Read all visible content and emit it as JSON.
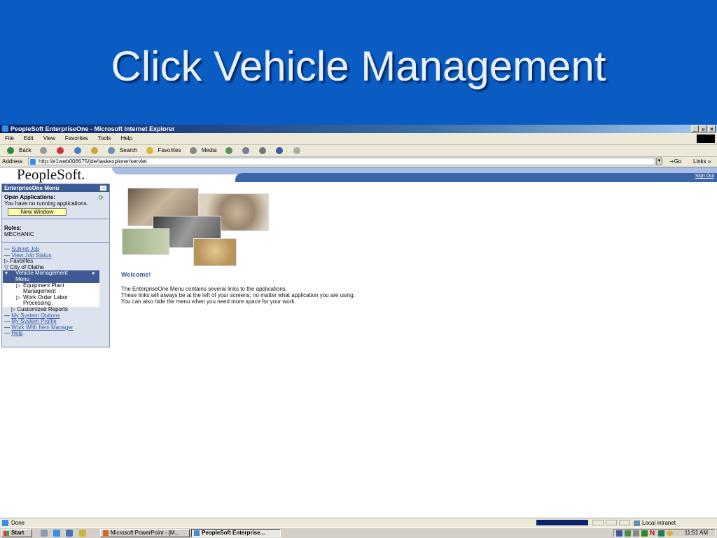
{
  "slide": {
    "title": "Click Vehicle Management"
  },
  "window": {
    "title": "PeopleSoft EnterpriseOne - Microsoft Internet Explorer",
    "controls": [
      "_",
      "»",
      "×"
    ]
  },
  "menu": [
    "File",
    "Edit",
    "View",
    "Favorites",
    "Tools",
    "Help"
  ],
  "toolbar": {
    "back": "Back",
    "search": "Search",
    "favorites": "Favorites",
    "media": "Media"
  },
  "address": {
    "label": "Address",
    "url": "http://e1web006675/jde/taskexplorer/servlet",
    "go": "Go",
    "links": "Links"
  },
  "portal": {
    "logo": "PeopleSoft.",
    "sign_out": "Sign Out"
  },
  "sidebar": {
    "header": "EnterpriseOne Menu",
    "open_apps_label": "Open Applications:",
    "no_apps": "You have no running applications.",
    "new_window": "New Window",
    "roles_label": "Roles:",
    "role": "MECHANIC",
    "tree": {
      "submit_job": "Submit Job",
      "view_job_status": "View Job Status",
      "favorites": "Favorites",
      "city": "City of Olathe",
      "vehicle_mgmt_line1": "Vehicle Management",
      "vehicle_mgmt_line2": "Menu",
      "equip_line1": "Equipment Plant",
      "equip_line2": "Management",
      "wo_line1": "Work Order Labor",
      "wo_line2": "Processing",
      "customized_reports": "Customized Reports",
      "system_options": "My System Options",
      "system_profile": "My System Profile",
      "item_manager": "Work With Item Manager",
      "help": "Help"
    }
  },
  "main": {
    "welcome": "Welcome!",
    "line1": "The EnterpriseOne Menu contains several links to the applications.",
    "line2": "These links will always be at the left of your screens, no matter what application you are using.",
    "line3": "You can also hide the menu when you need more space for your work."
  },
  "status": {
    "done": "Done",
    "zone": "Local intranet"
  },
  "taskbar": {
    "start": "Start",
    "task1": "Microsoft PowerPoint - [M...",
    "task2": "PeopleSoft Enterprise...",
    "clock": "11:51 AM"
  }
}
